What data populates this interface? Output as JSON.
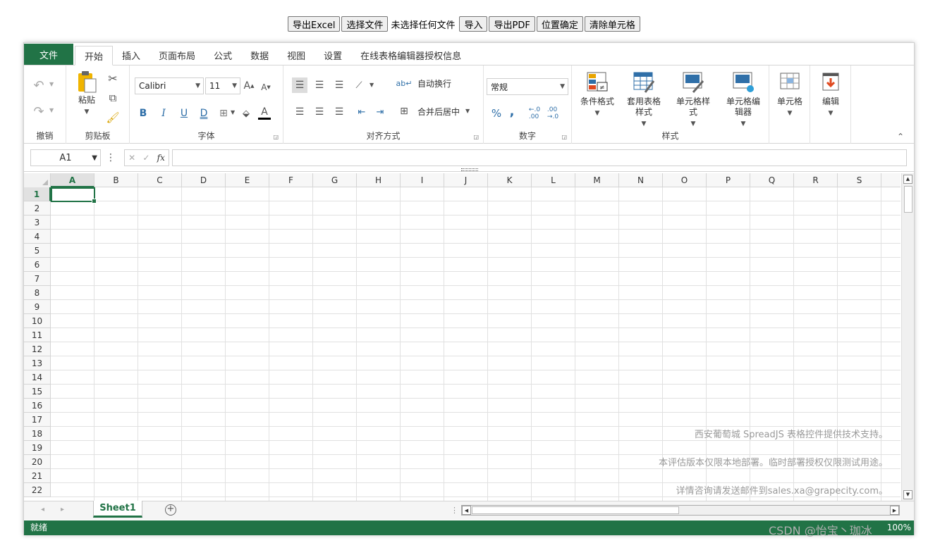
{
  "top_toolbar": {
    "export_excel": "导出Excel",
    "choose_file": "选择文件",
    "file_status": "未选择任何文件",
    "import": "导入",
    "export_pdf": "导出PDF",
    "confirm_position": "位置确定",
    "clear_cells": "清除单元格"
  },
  "tabs": [
    "文件",
    "开始",
    "插入",
    "页面布局",
    "公式",
    "数据",
    "视图",
    "设置",
    "在线表格编辑器授权信息"
  ],
  "ribbon": {
    "undo_group": "撤销",
    "clipboard": {
      "paste": "粘贴",
      "label": "剪贴板"
    },
    "font": {
      "family": "Calibri",
      "size": "11",
      "label": "字体",
      "bold": "B",
      "italic": "I",
      "underline": "U",
      "double_underline": "D",
      "font_color": "A"
    },
    "alignment": {
      "wrap": "自动换行",
      "merge": "合并后居中",
      "label": "对齐方式"
    },
    "number": {
      "format": "常规",
      "label": "数字",
      "percent": "%",
      "comma": ","
    },
    "styles": {
      "conditional": "条件格式",
      "table_style_1": "套用表格",
      "table_style_2": "样式",
      "cell_style_1": "单元格样",
      "cell_style_2": "式",
      "cell_editor_1": "单元格编",
      "cell_editor_2": "辑器",
      "label": "样式"
    },
    "cells": "单元格",
    "editing": "编辑"
  },
  "formula_bar": {
    "name_box": "A1",
    "fx": "fx"
  },
  "columns": [
    "A",
    "B",
    "C",
    "D",
    "E",
    "F",
    "G",
    "H",
    "I",
    "J",
    "K",
    "L",
    "M",
    "N",
    "O",
    "P",
    "Q",
    "R",
    "S"
  ],
  "rows": [
    "1",
    "2",
    "3",
    "4",
    "5",
    "6",
    "7",
    "8",
    "9",
    "10",
    "11",
    "12",
    "13",
    "14",
    "15",
    "16",
    "17",
    "18",
    "19",
    "20",
    "21",
    "22"
  ],
  "watermark": {
    "line1": "西安葡萄城 SpreadJS 表格控件提供技术支持。",
    "line2": "本评估版本仅限本地部署。临时部署授权仅限测试用途。",
    "line3": "详情咨询请发送邮件到sales.xa@grapecity.com。"
  },
  "sheet_tab": "Sheet1",
  "status": "就绪",
  "zoom": "100%",
  "csdn_watermark": "CSDN @怡宝丶珈冰",
  "colors": {
    "accent": "#217346"
  }
}
